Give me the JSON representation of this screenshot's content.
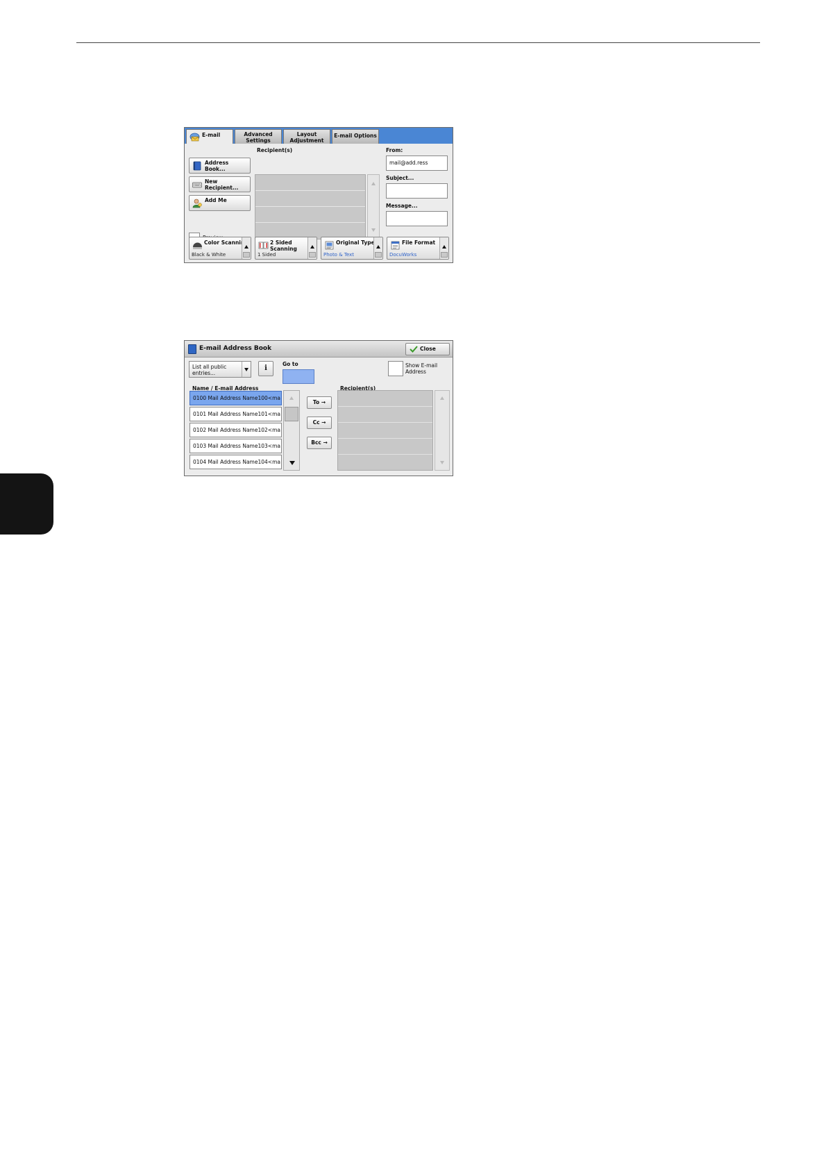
{
  "email_screen": {
    "tabs": [
      {
        "label": "E-mail",
        "active": true,
        "icon": "email-envelope-icon"
      },
      {
        "label": "Advanced Settings"
      },
      {
        "label": "Layout Adjustment"
      },
      {
        "label": "E-mail Options"
      }
    ],
    "left_buttons": [
      {
        "label": "Address Book...",
        "icon": "address-book-icon"
      },
      {
        "label": "New Recipient...",
        "icon": "keyboard-icon"
      },
      {
        "label": "Add Me",
        "icon": "person-add-icon"
      }
    ],
    "preview_label": "Preview",
    "recipients_label": "Recipient(s)",
    "from_label": "From:",
    "from_value": "mail@add.ress",
    "subject_label": "Subject...",
    "message_label": "Message...",
    "features": [
      {
        "label": "Color Scanning",
        "value": "Black & White",
        "icon": "color-scanning-icon"
      },
      {
        "label": "2 Sided Scanning",
        "value": "1 Sided",
        "icon": "two-sided-icon"
      },
      {
        "label": "Original Type",
        "value": "Photo & Text",
        "icon": "original-type-icon"
      },
      {
        "label": "File Format",
        "value": "DocuWorks",
        "icon": "file-format-icon"
      }
    ]
  },
  "address_book": {
    "title": "E-mail Address Book",
    "close_label": "Close",
    "dropdown_label": "List all public entries...",
    "info_label": "i",
    "goto_label": "Go to",
    "show_email_label": "Show E-mail Address",
    "name_list_label": "Name / E-mail Address",
    "recipients_label": "Recipient(s)",
    "entries": [
      "0100   Mail Address Name100<ma",
      "0101   Mail Address Name101<ma",
      "0102   Mail Address Name102<ma",
      "0103   Mail Address Name103<ma",
      "0104   Mail Address Name104<ma"
    ],
    "selected_index": 0,
    "actions": [
      "To →",
      "Cc →",
      "Bcc →"
    ]
  },
  "colors": {
    "accent_blue": "#4a86d4",
    "selection_blue": "#7aa6ee",
    "value_blue": "#2f63c9"
  }
}
